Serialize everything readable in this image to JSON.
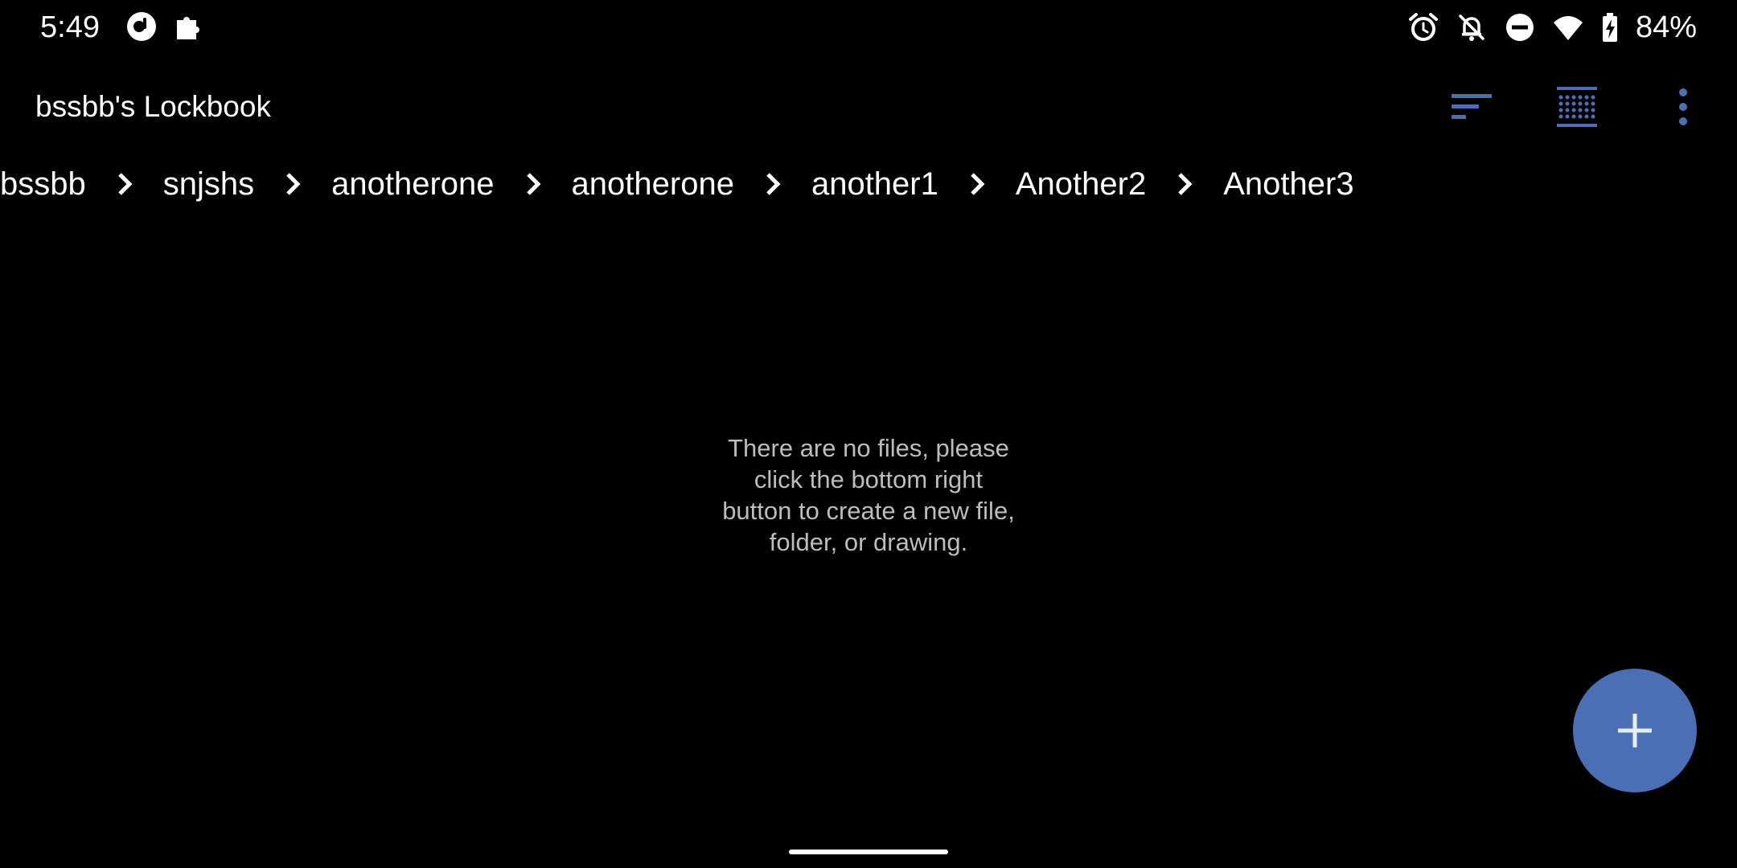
{
  "status_bar": {
    "time": "5:49",
    "battery_percent": "84%",
    "left_icons": [
      "podcast-app-icon",
      "puzzle-icon"
    ],
    "right_icons": [
      "alarm-icon",
      "notifications-off-icon",
      "do-not-disturb-icon",
      "wifi-icon",
      "battery-charging-icon"
    ]
  },
  "app_bar": {
    "title": "bssbb's Lockbook",
    "actions": [
      "sort-icon",
      "grid-view-icon",
      "more-vert-icon"
    ],
    "accent_color": "#4a6fb5"
  },
  "breadcrumb": {
    "items": [
      "bssbb",
      "snjshs",
      "anotherone",
      "anotherone",
      "another1",
      "Another2",
      "Another3"
    ],
    "separator_icon": "chevron-right-icon"
  },
  "empty_state": {
    "message_lines": [
      "There are no files, please",
      "click the bottom right",
      "button to create a new file,",
      "folder, or drawing."
    ]
  },
  "fab": {
    "icon": "plus-icon",
    "color": "#4a6fb5"
  }
}
